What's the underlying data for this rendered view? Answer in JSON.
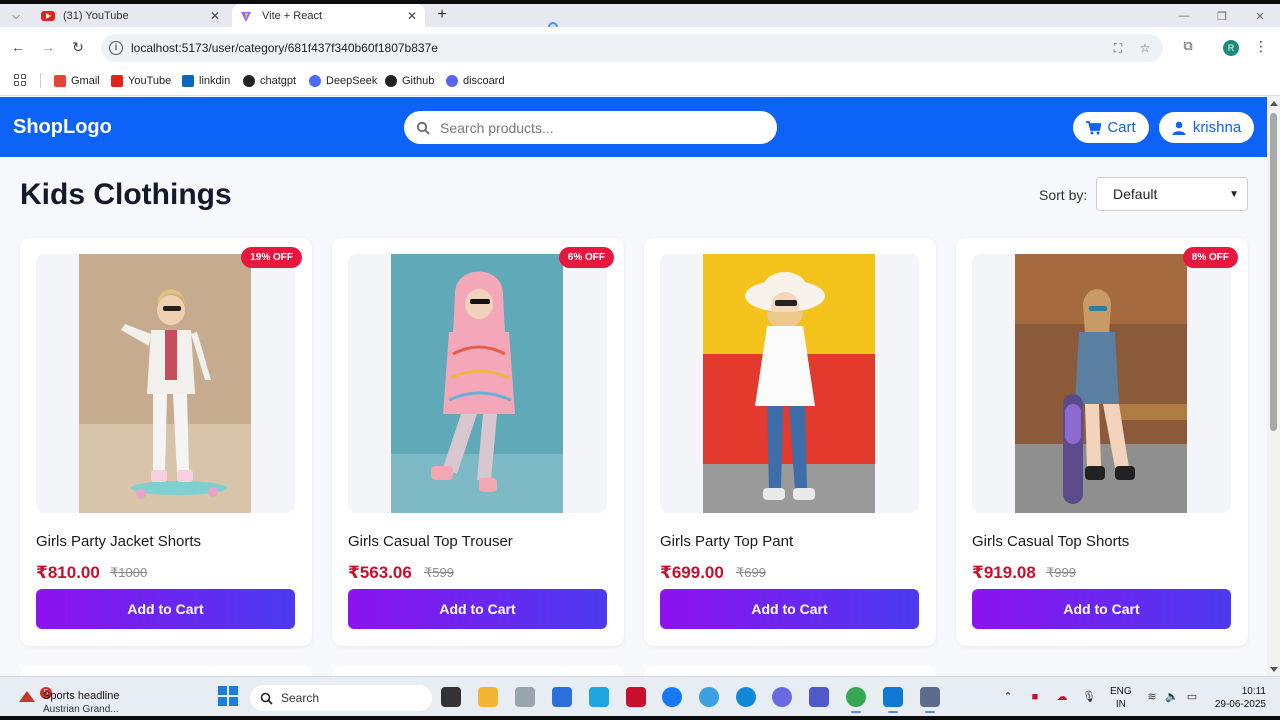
{
  "browser": {
    "tabs": [
      {
        "title": "(31) YouTube",
        "icon": "youtube-icon",
        "active": false
      },
      {
        "title": "Vite + React",
        "icon": "vite-icon",
        "active": true
      }
    ],
    "url": "localhost:5173/user/category/681f437f340b60f1807b837e",
    "profile_initial": "R",
    "bookmarks": [
      {
        "label": "Gmail",
        "icon": "gmail-icon",
        "color": "#ea4335"
      },
      {
        "label": "YouTube",
        "icon": "youtube-icon",
        "color": "#e62117"
      },
      {
        "label": "linkdin",
        "icon": "linkedin-icon",
        "color": "#0a66c2"
      },
      {
        "label": "chatgpt",
        "icon": "chatgpt-icon",
        "color": "#222222"
      },
      {
        "label": "DeepSeek",
        "icon": "deepseek-icon",
        "color": "#4d6bfe"
      },
      {
        "label": "Github",
        "icon": "github-icon",
        "color": "#222222"
      },
      {
        "label": "discoard",
        "icon": "discord-icon",
        "color": "#5865f2"
      }
    ]
  },
  "site": {
    "logo": "ShopLogo",
    "search_placeholder": "Search products...",
    "cart_label": "Cart",
    "user_label": "krishna",
    "brand_color": "#0d63f8"
  },
  "category": {
    "title": "Kids Clothings",
    "sort_label": "Sort by:",
    "sort_value": "Default"
  },
  "products": [
    {
      "name": "Girls Party Jacket Shorts",
      "price": "₹810.00",
      "mrp": "₹1000",
      "discount": "19% OFF",
      "button": "Add to Cart"
    },
    {
      "name": "Girls Casual Top Trouser",
      "price": "₹563.06",
      "mrp": "₹599",
      "discount": "6% OFF",
      "button": "Add to Cart"
    },
    {
      "name": "Girls Party Top Pant",
      "price": "₹699.00",
      "mrp": "₹699",
      "discount": "",
      "button": "Add to Cart"
    },
    {
      "name": "Girls Casual Top Shorts",
      "price": "₹919.08",
      "mrp": "₹999",
      "discount": "8% OFF",
      "button": "Add to Cart"
    }
  ],
  "taskbar": {
    "news_count": "5",
    "news_title": "Sports headline",
    "news_subtitle": "Austrian Grand...",
    "search_label": "Search",
    "lang_top": "ENG",
    "lang_bottom": "IN",
    "time": "10:11",
    "date": "29-06-2025"
  }
}
